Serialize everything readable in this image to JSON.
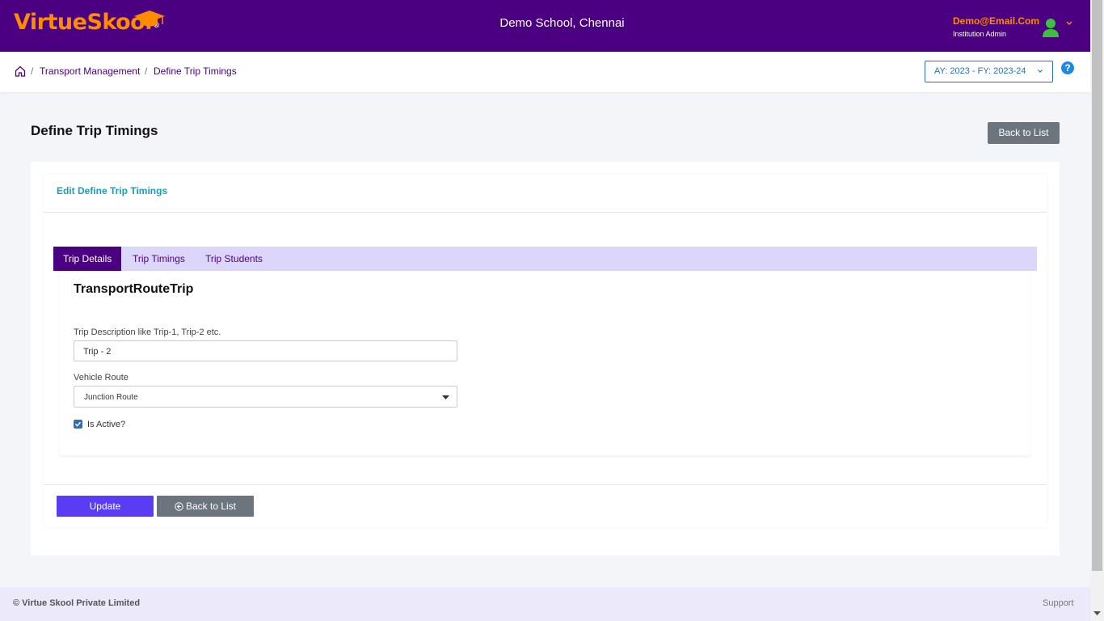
{
  "header": {
    "logo_part1": "Virtue",
    "logo_part2": "Skool",
    "logo_reg": "®",
    "school_name": "Demo School, Chennai",
    "user_email": "Demo@Email.Com",
    "user_role": "Institution Admin"
  },
  "breadcrumb": {
    "items": [
      "Transport Management",
      "Define Trip Timings"
    ],
    "separator": "/"
  },
  "year_selector": {
    "value": "AY: 2023 - FY: 2023-24"
  },
  "help_label": "?",
  "page": {
    "title": "Define Trip Timings",
    "back_label": "Back to List"
  },
  "card": {
    "title": "Edit Define Trip Timings",
    "tabs": [
      {
        "label": "Trip Details",
        "active": true
      },
      {
        "label": "Trip Timings",
        "active": false
      },
      {
        "label": "Trip Students",
        "active": false
      }
    ]
  },
  "form": {
    "section_title": "TransportRouteTrip",
    "description_label": "Trip Description like Trip-1, Trip-2 etc.",
    "description_value": "Trip - 2",
    "route_label": "Vehicle Route",
    "route_value": "Junction Route",
    "active_label": "Is Active?",
    "active_checked": true
  },
  "actions": {
    "update_label": "Update",
    "back_label": "Back to List"
  },
  "footer": {
    "copyright": "© Virtue Skool Private Limited",
    "support": "Support"
  },
  "colors": {
    "brand": "#4b0082",
    "accent_orange": "#ff8c00",
    "primary_button": "#5b3cf5",
    "secondary_button": "#6c757d",
    "link_teal": "#1a9fb5",
    "tab_bar": "#dcd6fb"
  },
  "icons": [
    "graduation-cap-icon",
    "user-avatar-icon",
    "chevron-down-icon",
    "home-icon",
    "help-icon",
    "caret-down-icon",
    "check-icon",
    "arrow-left-circle-icon"
  ]
}
